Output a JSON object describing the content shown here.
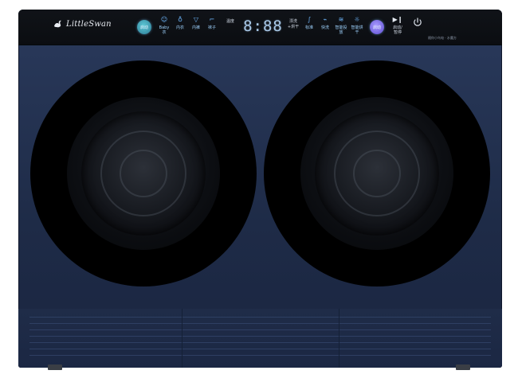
{
  "brand": {
    "name": "LittleSwan"
  },
  "panel": {
    "left_button": "启动",
    "right_button": "启动",
    "programs": [
      {
        "label": "Baby衣",
        "icon": "baby-clothes-icon"
      },
      {
        "label": "内衣",
        "icon": "underwear-icon"
      },
      {
        "label": "内裤",
        "icon": "briefs-icon"
      },
      {
        "label": "袜子",
        "icon": "sock-icon"
      },
      {
        "label": "温度",
        "icon": "temperature-icon"
      }
    ],
    "display": "8:88",
    "right_programs": [
      {
        "label": "漂洗",
        "sub": "+烘干"
      },
      {
        "label": "标准",
        "icon": "standard-icon"
      },
      {
        "label": "快洗",
        "icon": "quick-wash-icon"
      },
      {
        "label": "智能投放",
        "icon": "detergent-icon"
      },
      {
        "label": "智能烘干",
        "icon": "dry-icon"
      }
    ],
    "extra_label": "智能",
    "play_label": "启动/暂停",
    "subtags": "随你小鸟电 · 水魔方"
  },
  "colors": {
    "body": "#1e2b47",
    "panel": "#0b0d11",
    "accent_left": "#3aa3b8",
    "accent_right": "#6b5be0",
    "chrome": "#c8ccd2"
  }
}
